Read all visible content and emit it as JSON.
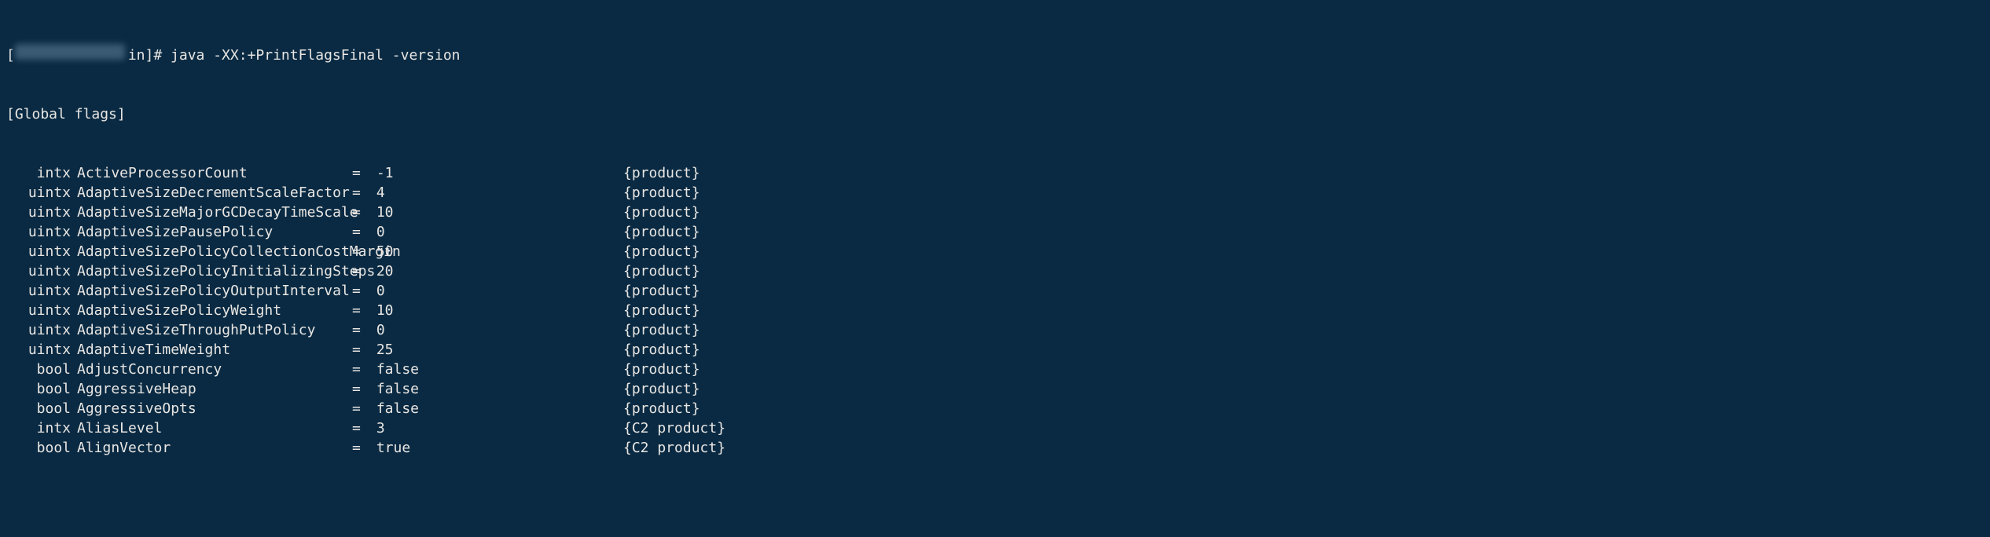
{
  "prompt": {
    "bracket_open": "[",
    "redacted_host": true,
    "suffix": "in]# ",
    "command": "java -XX:+PrintFlagsFinal -version"
  },
  "header": "[Global flags]",
  "flags": [
    {
      "type": "intx",
      "name": "ActiveProcessorCount",
      "value": "-1",
      "category": "{product}"
    },
    {
      "type": "uintx",
      "name": "AdaptiveSizeDecrementScaleFactor",
      "value": "4",
      "category": "{product}"
    },
    {
      "type": "uintx",
      "name": "AdaptiveSizeMajorGCDecayTimeScale",
      "value": "10",
      "category": "{product}"
    },
    {
      "type": "uintx",
      "name": "AdaptiveSizePausePolicy",
      "value": "0",
      "category": "{product}"
    },
    {
      "type": "uintx",
      "name": "AdaptiveSizePolicyCollectionCostMargin",
      "value": "50",
      "category": "{product}"
    },
    {
      "type": "uintx",
      "name": "AdaptiveSizePolicyInitializingSteps",
      "value": "20",
      "category": "{product}"
    },
    {
      "type": "uintx",
      "name": "AdaptiveSizePolicyOutputInterval",
      "value": "0",
      "category": "{product}"
    },
    {
      "type": "uintx",
      "name": "AdaptiveSizePolicyWeight",
      "value": "10",
      "category": "{product}"
    },
    {
      "type": "uintx",
      "name": "AdaptiveSizeThroughPutPolicy",
      "value": "0",
      "category": "{product}"
    },
    {
      "type": "uintx",
      "name": "AdaptiveTimeWeight",
      "value": "25",
      "category": "{product}"
    },
    {
      "type": "bool",
      "name": "AdjustConcurrency",
      "value": "false",
      "category": "{product}"
    },
    {
      "type": "bool",
      "name": "AggressiveHeap",
      "value": "false",
      "category": "{product}"
    },
    {
      "type": "bool",
      "name": "AggressiveOpts",
      "value": "false",
      "category": "{product}"
    },
    {
      "type": "intx",
      "name": "AliasLevel",
      "value": "3",
      "category": "{C2 product}"
    },
    {
      "type": "bool",
      "name": "AlignVector",
      "value": "true",
      "category": "{C2 product}"
    }
  ],
  "eq": "="
}
